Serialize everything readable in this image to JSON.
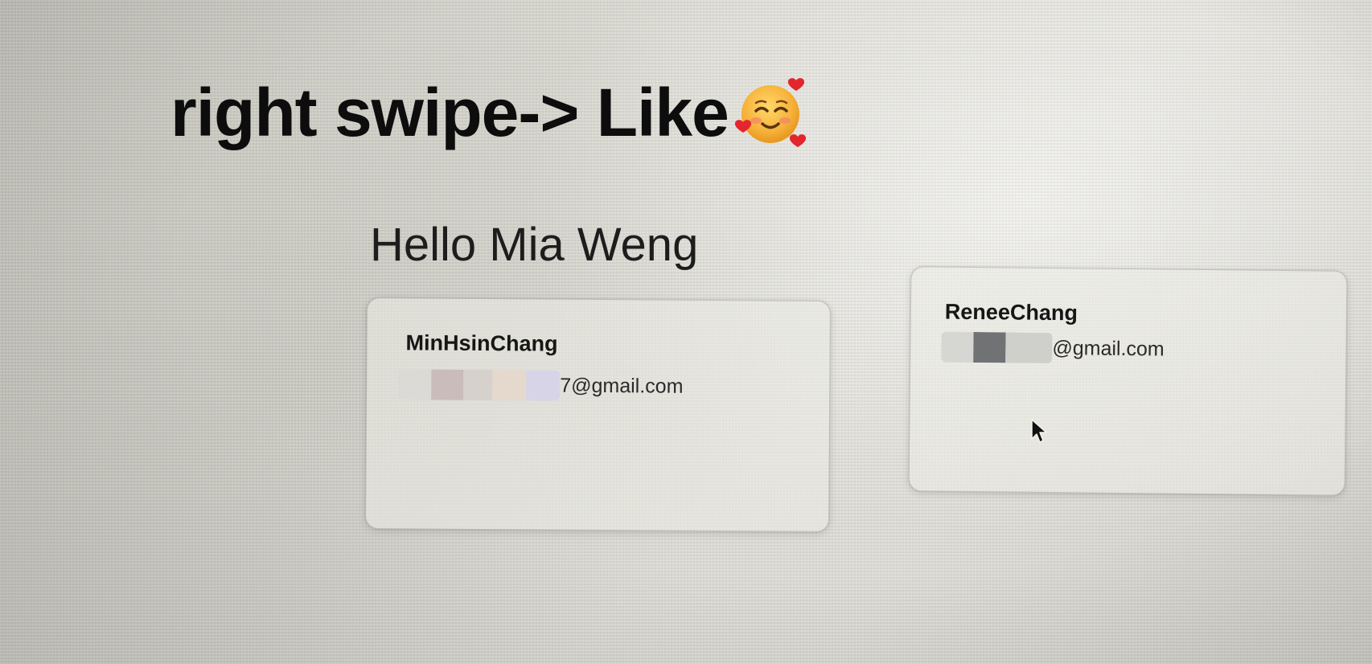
{
  "annotation": {
    "text": "right swipe-> Like",
    "emoji": "smiling-face-with-hearts"
  },
  "greeting": "Hello Mia Weng",
  "cards": [
    {
      "name": "MinHsinChang",
      "email_visible_suffix": "7@gmail.com",
      "email_redacted": true
    },
    {
      "name": "ReneeChang",
      "email_visible_suffix": "@gmail.com",
      "email_redacted": true
    }
  ],
  "colors": {
    "text_primary": "#0d0d0d",
    "card_border": "#9a9a9a",
    "emoji_face": "#f6b23a",
    "emoji_heart": "#e3262e"
  }
}
